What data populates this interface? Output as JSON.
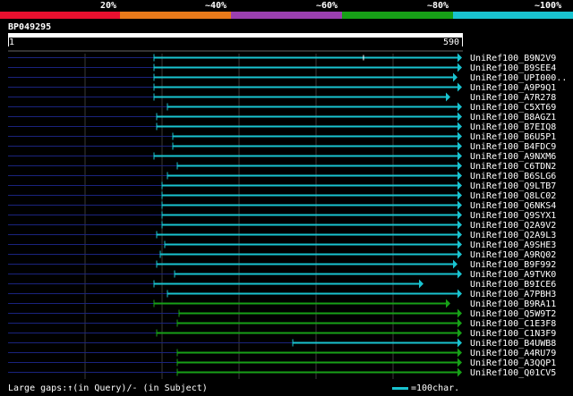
{
  "legend": {
    "labels": [
      "20%",
      "~40%",
      "~60%",
      "~80%",
      "~100%"
    ],
    "colors": [
      "#e8102f",
      "#e87a1a",
      "#9b3fb0",
      "#17a017",
      "#19c3d0"
    ]
  },
  "query": {
    "id": "BP049295",
    "start": "1",
    "end": "590"
  },
  "footer": {
    "gaps": "Large gaps:↑(in Query)/- (in Subject)",
    "scale": "=100char."
  },
  "hits": [
    {
      "label": "UniRef100_B9N2V9",
      "start": 172,
      "end": 516,
      "color": "cyan",
      "mark": 406
    },
    {
      "label": "UniRef100_B9SEE4",
      "start": 172,
      "end": 516,
      "color": "cyan"
    },
    {
      "label": "UniRef100_UPI000..",
      "start": 172,
      "end": 511,
      "color": "cyan"
    },
    {
      "label": "UniRef100_A9P9Q1",
      "start": 172,
      "end": 516,
      "color": "cyan"
    },
    {
      "label": "UniRef100_A7R278",
      "start": 172,
      "end": 503,
      "color": "cyan"
    },
    {
      "label": "UniRef100_C5XT69",
      "start": 187,
      "end": 516,
      "color": "cyan"
    },
    {
      "label": "UniRef100_B8AGZ1",
      "start": 175,
      "end": 516,
      "color": "cyan"
    },
    {
      "label": "UniRef100_B7EIQ8",
      "start": 175,
      "end": 516,
      "color": "cyan"
    },
    {
      "label": "UniRef100_B6U5P1",
      "start": 193,
      "end": 516,
      "color": "cyan"
    },
    {
      "label": "UniRef100_B4FDC9",
      "start": 193,
      "end": 516,
      "color": "cyan"
    },
    {
      "label": "UniRef100_A9NXM6",
      "start": 172,
      "end": 516,
      "color": "cyan"
    },
    {
      "label": "UniRef100_C6TDN2",
      "start": 198,
      "end": 516,
      "color": "cyan"
    },
    {
      "label": "UniRef100_B6SLG6",
      "start": 187,
      "end": 516,
      "color": "cyan"
    },
    {
      "label": "UniRef100_Q9LTB7",
      "start": 181,
      "end": 516,
      "color": "cyan"
    },
    {
      "label": "UniRef100_Q8LC02",
      "start": 181,
      "end": 516,
      "color": "cyan"
    },
    {
      "label": "UniRef100_Q6NKS4",
      "start": 181,
      "end": 516,
      "color": "cyan"
    },
    {
      "label": "UniRef100_Q9SYX1",
      "start": 181,
      "end": 516,
      "color": "cyan"
    },
    {
      "label": "UniRef100_Q2A9V2",
      "start": 181,
      "end": 516,
      "color": "cyan"
    },
    {
      "label": "UniRef100_Q2A9L3",
      "start": 175,
      "end": 516,
      "color": "cyan"
    },
    {
      "label": "UniRef100_A9SHE3",
      "start": 184,
      "end": 516,
      "color": "cyan"
    },
    {
      "label": "UniRef100_A9RQ02",
      "start": 179,
      "end": 516,
      "color": "cyan"
    },
    {
      "label": "UniRef100_B9F992",
      "start": 175,
      "end": 511,
      "color": "cyan"
    },
    {
      "label": "UniRef100_A9TVK0",
      "start": 195,
      "end": 516,
      "color": "cyan"
    },
    {
      "label": "UniRef100_B9ICE6",
      "start": 172,
      "end": 473,
      "color": "cyan"
    },
    {
      "label": "UniRef100_A7PBH3",
      "start": 187,
      "end": 516,
      "color": "cyan"
    },
    {
      "label": "UniRef100_B9RA11",
      "start": 172,
      "end": 503,
      "color": "green"
    },
    {
      "label": "UniRef100_Q5W9T2",
      "start": 200,
      "end": 516,
      "color": "green"
    },
    {
      "label": "UniRef100_C1E3F8",
      "start": 198,
      "end": 516,
      "color": "green"
    },
    {
      "label": "UniRef100_C1N3F9",
      "start": 175,
      "end": 516,
      "color": "green"
    },
    {
      "label": "UniRef100_B4UWB8",
      "start": 327,
      "end": 516,
      "color": "cyan"
    },
    {
      "label": "UniRef100_A4RU79",
      "start": 198,
      "end": 516,
      "color": "green"
    },
    {
      "label": "UniRef100_A3QQP1",
      "start": 198,
      "end": 516,
      "color": "green"
    },
    {
      "label": "UniRef100_Q01CV5",
      "start": 198,
      "end": 516,
      "color": "green"
    }
  ]
}
